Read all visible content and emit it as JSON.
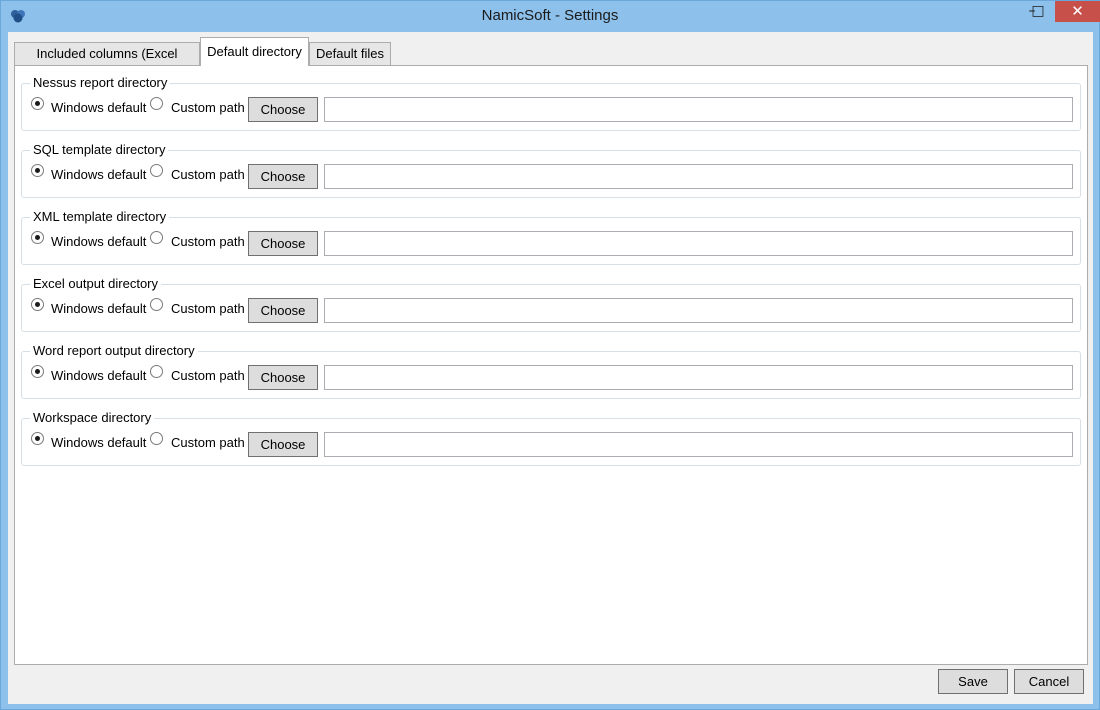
{
  "window": {
    "title": "NamicSoft - Settings",
    "minimize_icon": "minimize-icon",
    "maximize_icon": "maximize-icon",
    "close_icon": "close-icon",
    "min_glyph": "–",
    "max_glyph": "□",
    "close_glyph": "✕"
  },
  "tabs": [
    {
      "label": "Included columns (Excel export)"
    },
    {
      "label": "Default directory"
    },
    {
      "label": "Default files"
    }
  ],
  "active_tab": "Default directory",
  "groups": [
    {
      "title": "Nessus report directory",
      "windows_default": "Windows default",
      "custom_path": "Custom path",
      "choose": "Choose",
      "path_value": "",
      "selected": "Windows default"
    },
    {
      "title": "SQL template directory",
      "windows_default": "Windows default",
      "custom_path": "Custom path",
      "choose": "Choose",
      "path_value": "",
      "selected": "Windows default"
    },
    {
      "title": "XML template directory",
      "windows_default": "Windows default",
      "custom_path": "Custom path",
      "choose": "Choose",
      "path_value": "",
      "selected": "Windows default"
    },
    {
      "title": "Excel output directory",
      "windows_default": "Windows default",
      "custom_path": "Custom path",
      "choose": "Choose",
      "path_value": "",
      "selected": "Windows default"
    },
    {
      "title": "Word report output directory",
      "windows_default": "Windows default",
      "custom_path": "Custom path",
      "choose": "Choose",
      "path_value": "",
      "selected": "Windows default"
    },
    {
      "title": "Workspace directory",
      "windows_default": "Windows default",
      "custom_path": "Custom path",
      "choose": "Choose",
      "path_value": "",
      "selected": "Windows default"
    }
  ],
  "footer": {
    "save_label": "Save",
    "cancel_label": "Cancel"
  },
  "colors": {
    "titlebar": "#8dc0ea",
    "close_button": "#c7504b",
    "panel": "#ffffff",
    "client": "#f0f0f0"
  }
}
